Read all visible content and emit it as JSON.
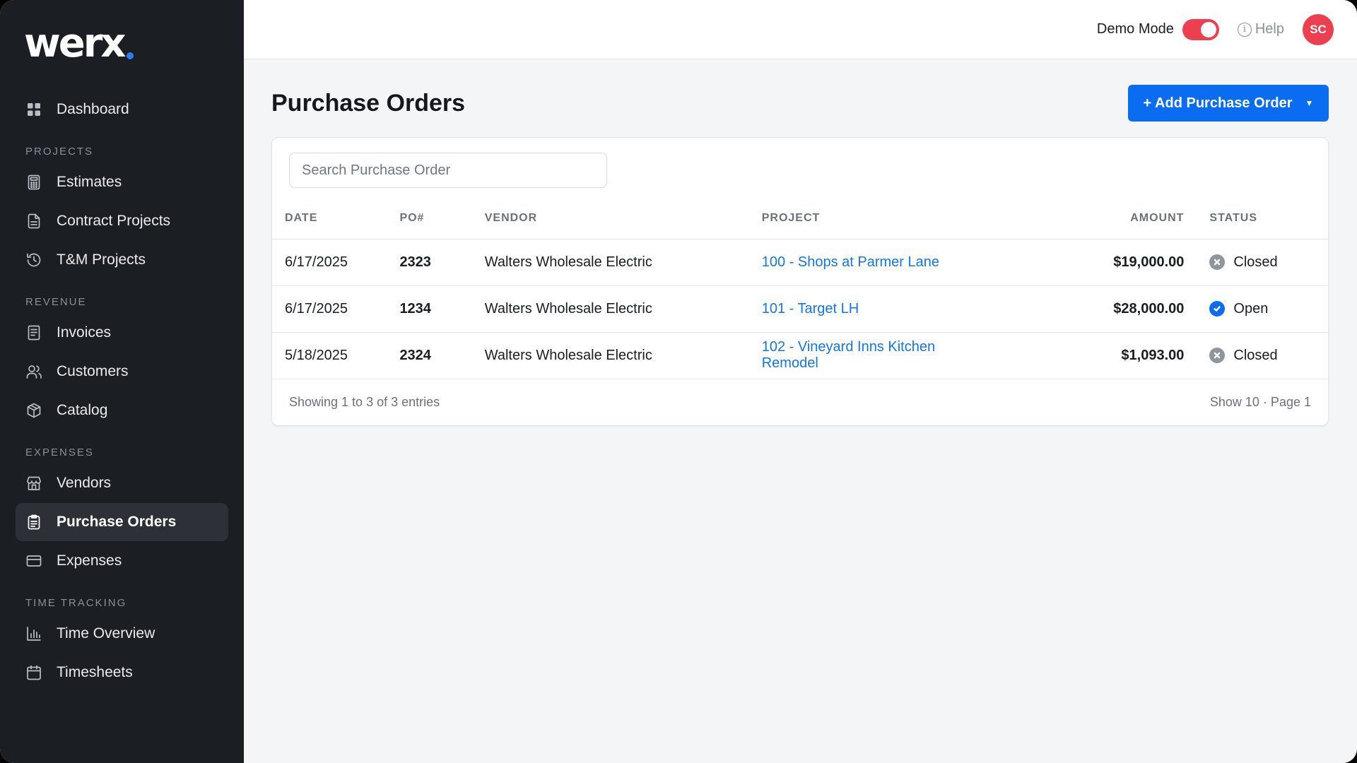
{
  "brand": {
    "logo_text": "werx",
    "accent": "#2f7bf5"
  },
  "topbar": {
    "demo_mode_label": "Demo Mode",
    "demo_mode_on": true,
    "help_label": "Help",
    "avatar_initials": "SC",
    "toggle_color": "#ec3f4f"
  },
  "sidebar": {
    "dashboard": "Dashboard",
    "sections": {
      "projects": "PROJECTS",
      "revenue": "REVENUE",
      "expenses": "EXPENSES",
      "time_tracking": "TIME TRACKING"
    },
    "items": {
      "estimates": "Estimates",
      "contract_projects": "Contract Projects",
      "tm_projects": "T&M Projects",
      "invoices": "Invoices",
      "customers": "Customers",
      "catalog": "Catalog",
      "vendors": "Vendors",
      "purchase_orders": "Purchase Orders",
      "expenses": "Expenses",
      "time_overview": "Time Overview",
      "timesheets": "Timesheets"
    },
    "active_item": "purchase_orders"
  },
  "page": {
    "title": "Purchase Orders",
    "add_button_label": "+ Add Purchase Order",
    "search_placeholder": "Search Purchase Order"
  },
  "table": {
    "columns": {
      "date": "DATE",
      "po": "PO#",
      "vendor": "VENDOR",
      "project": "PROJECT",
      "amount": "AMOUNT",
      "status": "STATUS"
    },
    "rows": [
      {
        "date": "6/17/2025",
        "po": "2323",
        "vendor": "Walters Wholesale Electric",
        "project": "100 - Shops at Parmer Lane",
        "amount": "$19,000.00",
        "status": "Closed"
      },
      {
        "date": "6/17/2025",
        "po": "1234",
        "vendor": "Walters Wholesale Electric",
        "project": "101 - Target LH",
        "amount": "$28,000.00",
        "status": "Open"
      },
      {
        "date": "5/18/2025",
        "po": "2324",
        "vendor": "Walters Wholesale Electric",
        "project": "102 - Vineyard Inns Kitchen Remodel",
        "amount": "$1,093.00",
        "status": "Closed"
      }
    ],
    "footer_left": "Showing 1 to 3 of 3 entries",
    "footer_right": "Show 10 · Page 1"
  },
  "icons": {
    "dashboard": "grid-icon",
    "estimates": "calculator-icon",
    "contract_projects": "document-icon",
    "tm_projects": "history-icon",
    "invoices": "invoice-icon",
    "customers": "users-icon",
    "catalog": "box-icon",
    "vendors": "store-icon",
    "purchase_orders": "clipboard-icon",
    "expenses": "card-icon",
    "time_overview": "bar-chart-icon",
    "timesheets": "calendar-icon"
  }
}
